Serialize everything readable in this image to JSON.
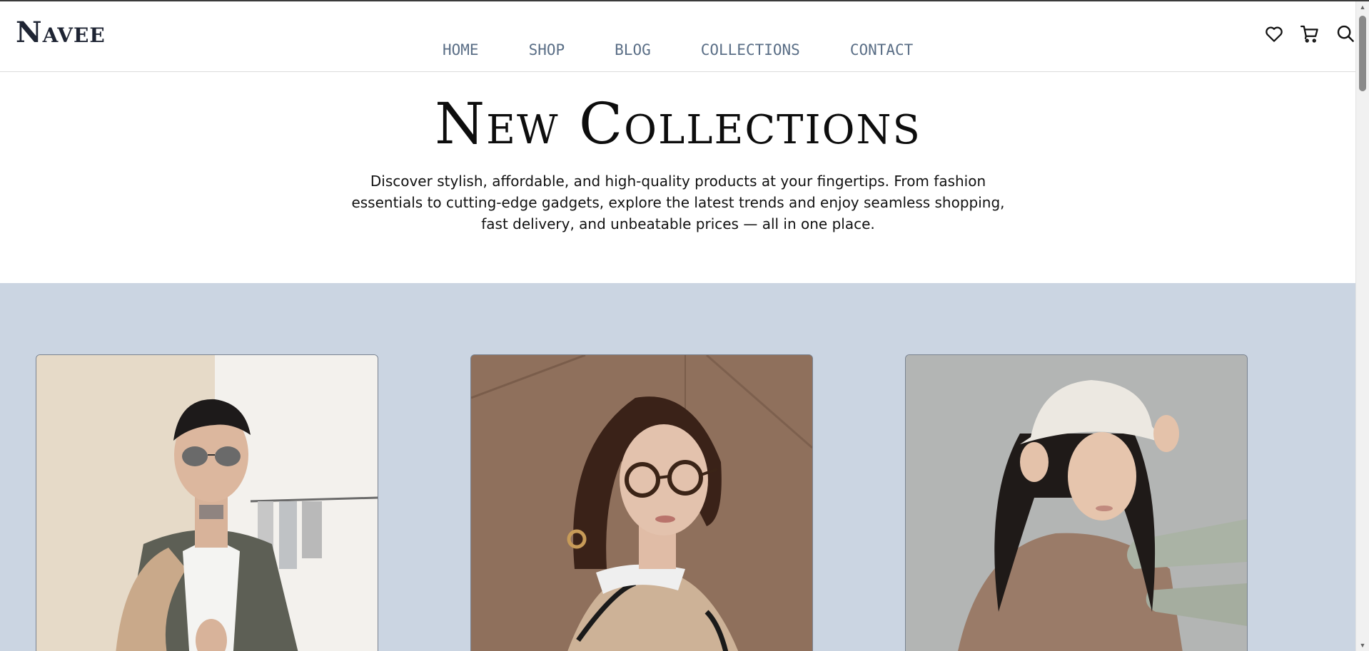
{
  "brand": {
    "logo": "Navee"
  },
  "nav": {
    "items": [
      {
        "label": "HOME"
      },
      {
        "label": "SHOP"
      },
      {
        "label": "BLOG"
      },
      {
        "label": "COLLECTIONS"
      },
      {
        "label": "CONTACT"
      }
    ]
  },
  "header_icons": [
    "heart-icon",
    "cart-icon",
    "search-icon"
  ],
  "hero": {
    "title": "New Collections",
    "description": "Discover stylish, affordable, and high-quality products at your fingertips. From fashion essentials to cutting-edge gadgets, explore the latest trends and enjoy seamless shopping, fast delivery, and unbeatable prices — all in one place."
  },
  "colors": {
    "section_background": "#cbd5e2",
    "nav_text": "#5a6e86",
    "logo": "#1e2433"
  },
  "collections": {
    "cards": [
      {
        "image": "man-sunglasses-leather-jacket-photo"
      },
      {
        "image": "woman-round-glasses-photo"
      },
      {
        "image": "woman-bucket-hat-photo"
      }
    ]
  }
}
